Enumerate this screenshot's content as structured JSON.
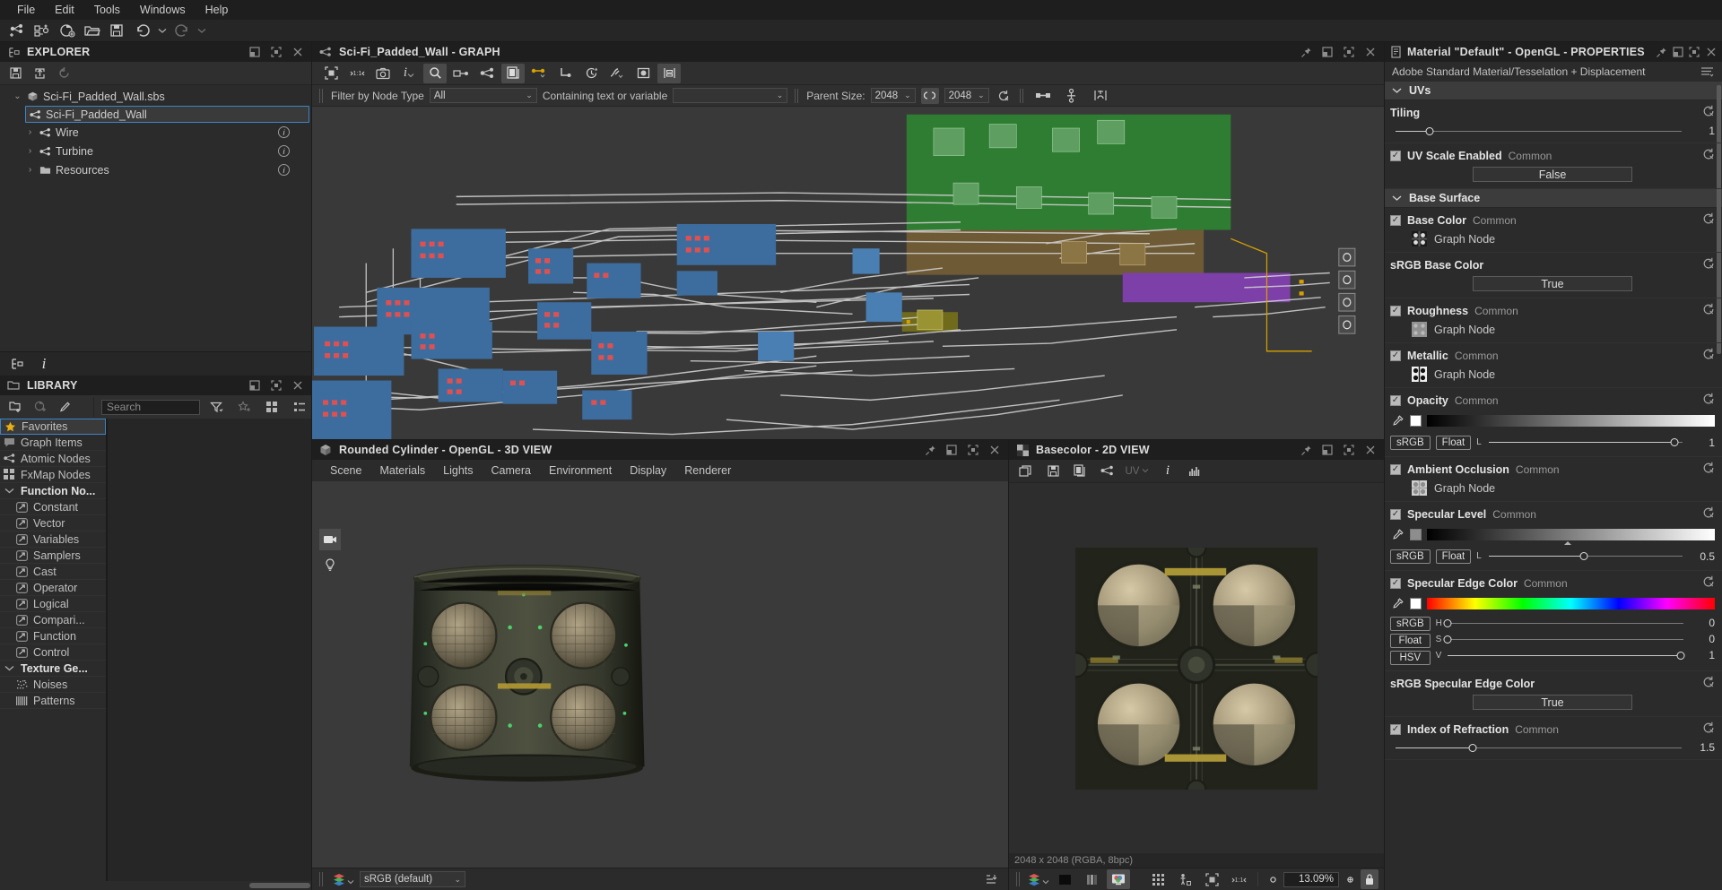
{
  "menubar": [
    "File",
    "Edit",
    "Tools",
    "Windows",
    "Help"
  ],
  "main_toolbar": [
    {
      "name": "new-graph-icon",
      "title": "New Graph"
    },
    {
      "name": "new-substance-icon",
      "title": "New Substance"
    },
    {
      "name": "new-package-icon",
      "title": "New Package"
    },
    {
      "name": "open-folder-icon",
      "title": "Open"
    },
    {
      "name": "save-icon",
      "title": "Save"
    },
    {
      "name": "undo-icon",
      "title": "Undo"
    },
    {
      "name": "undo-dropdown-icon",
      "title": "Undo history"
    },
    {
      "name": "redo-icon",
      "title": "Redo"
    },
    {
      "name": "redo-dropdown-icon",
      "title": "Redo history"
    }
  ],
  "explorer": {
    "title": "EXPLORER",
    "toolbar": [
      "save-package-icon",
      "export-icon",
      "refresh-icon"
    ],
    "tree": [
      {
        "label": "Sci-Fi_Padded_Wall.sbs",
        "icon": "package-icon",
        "depth": 0,
        "expanded": true,
        "selected": false,
        "info": false
      },
      {
        "label": "Sci-Fi_Padded_Wall",
        "icon": "graph-icon",
        "depth": 1,
        "expanded": false,
        "selected": true,
        "info": false
      },
      {
        "label": "Wire",
        "icon": "graph-icon",
        "depth": 1,
        "expanded": false,
        "selected": false,
        "info": true
      },
      {
        "label": "Turbine",
        "icon": "graph-icon",
        "depth": 1,
        "expanded": false,
        "selected": false,
        "info": true
      },
      {
        "label": "Resources",
        "icon": "folder-icon",
        "depth": 1,
        "expanded": false,
        "selected": false,
        "info": true
      }
    ],
    "bottom_tabs": [
      "explorer-tab-icon",
      "info-tab-icon"
    ]
  },
  "library": {
    "title": "LIBRARY",
    "toolbar": [
      "new-category-icon",
      "new-item-icon",
      "edit-icon"
    ],
    "search": {
      "value": "",
      "placeholder": "Search"
    },
    "filter_icons": [
      "filter-icon",
      "favorite-filter-icon",
      "grid-view-icon",
      "list-view-icon"
    ],
    "items": [
      {
        "label": "Favorites",
        "icon": "star-icon",
        "type": "item",
        "selected": true
      },
      {
        "label": "Graph Items",
        "icon": "comment-icon",
        "type": "item",
        "selected": false
      },
      {
        "label": "Atomic Nodes",
        "icon": "atomic-icon",
        "type": "item",
        "selected": false
      },
      {
        "label": "FxMap Nodes",
        "icon": "fxmap-icon",
        "type": "item",
        "selected": false
      },
      {
        "label": "Function No...",
        "icon": "chevron-down-icon",
        "type": "group",
        "selected": false
      },
      {
        "label": "Constant",
        "icon": "function-icon",
        "type": "sub",
        "selected": false
      },
      {
        "label": "Vector",
        "icon": "function-icon",
        "type": "sub",
        "selected": false
      },
      {
        "label": "Variables",
        "icon": "function-icon",
        "type": "sub",
        "selected": false
      },
      {
        "label": "Samplers",
        "icon": "function-icon",
        "type": "sub",
        "selected": false
      },
      {
        "label": "Cast",
        "icon": "function-icon",
        "type": "sub",
        "selected": false
      },
      {
        "label": "Operator",
        "icon": "function-icon",
        "type": "sub",
        "selected": false
      },
      {
        "label": "Logical",
        "icon": "function-icon",
        "type": "sub",
        "selected": false
      },
      {
        "label": "Compari...",
        "icon": "function-icon",
        "type": "sub",
        "selected": false
      },
      {
        "label": "Function",
        "icon": "function-icon",
        "type": "sub",
        "selected": false
      },
      {
        "label": "Control",
        "icon": "function-icon",
        "type": "sub",
        "selected": false
      },
      {
        "label": "Texture Ge...",
        "icon": "chevron-down-icon",
        "type": "group",
        "selected": false
      },
      {
        "label": "Noises",
        "icon": "noise-icon",
        "type": "sub",
        "selected": false
      },
      {
        "label": "Patterns",
        "icon": "pattern-icon",
        "type": "sub",
        "selected": false
      }
    ]
  },
  "graph": {
    "title": "Sci-Fi_Padded_Wall - GRAPH",
    "toolbar": [
      "fit-frame-icon",
      "scale-1to1-icon",
      "camera-icon",
      "info-icon",
      "search-icon",
      "link-creation-icon",
      "atomic-node-icon",
      "copy-node-icon",
      "connect-dots-icon",
      "polyline-link-icon",
      "timer-icon",
      "curve-link-icon",
      "preview-node-icon",
      "align-nodes-icon"
    ],
    "filter_label": "Filter by Node Type",
    "filter_value": "All",
    "contains_label": "Containing text or variable",
    "contains_value": "",
    "parent_size_label": "Parent Size:",
    "parent_size_w": "2048",
    "parent_size_h": "2048",
    "right_icons": [
      "link-toggle-icon",
      "node-chain-icon",
      "graph-settings-icon"
    ]
  },
  "view3d": {
    "title": "Rounded Cylinder - OpenGL - 3D VIEW",
    "menu": [
      "Scene",
      "Materials",
      "Lights",
      "Camera",
      "Environment",
      "Display",
      "Renderer"
    ],
    "colorspace": "sRGB (default)",
    "left_icons": [
      "camera-icon",
      "light-bulb-icon"
    ],
    "status_right_icon": "sort-icon"
  },
  "view2d": {
    "title": "Basecolor - 2D VIEW",
    "toolbar": [
      "duplicate-view-icon",
      "save-image-icon",
      "copy-image-icon",
      "link-graph-icon",
      "uv-icon",
      "info-icon",
      "histogram-icon"
    ],
    "uv_label": "UV",
    "image_info": "2048 x 2048 (RGBA, 8bpc)",
    "channel_icons": [
      "layers-icon",
      "black-swatch-icon",
      "channels-icon",
      "rgb-view-icon"
    ],
    "right_icons": [
      "tiling-grid-icon",
      "human-scale-icon",
      "fit-icon",
      "scale-1to1-icon"
    ],
    "zoom_out": "-",
    "zoom_value": "13.09%",
    "zoom_in": "+",
    "lock_icon": "lock-icon"
  },
  "properties": {
    "title": "Material \"Default\" - OpenGL - PROPERTIES",
    "subtitle": "Adobe Standard Material/Tesselation + Displacement",
    "menu_icon": "properties-menu-icon",
    "sections": [
      {
        "name": "UVs",
        "items": [
          {
            "kind": "slider",
            "label": "Tiling",
            "checkbox": false,
            "value": "1",
            "pct": 12
          },
          {
            "kind": "enum",
            "label": "UV Scale Enabled",
            "common": "Common",
            "checkbox": true,
            "value": "False"
          }
        ]
      },
      {
        "name": "Base Surface",
        "items": [
          {
            "kind": "node",
            "label": "Base Color",
            "common": "Common",
            "checkbox": true,
            "node": "Graph Node",
            "thumb": "basecolor"
          },
          {
            "kind": "enum",
            "label": "sRGB Base Color",
            "checkbox": false,
            "value": "True"
          },
          {
            "kind": "node",
            "label": "Roughness",
            "common": "Common",
            "checkbox": true,
            "node": "Graph Node",
            "thumb": "roughness"
          },
          {
            "kind": "node",
            "label": "Metallic",
            "common": "Common",
            "checkbox": true,
            "node": "Graph Node",
            "thumb": "metallic"
          },
          {
            "kind": "colorfloat",
            "label": "Opacity",
            "common": "Common",
            "checkbox": true,
            "swatch": "#ffffff",
            "gradient": "bw",
            "tags": [
              "sRGB",
              "Float"
            ],
            "channel": "L",
            "value": "1",
            "pct": 96
          },
          {
            "kind": "node",
            "label": "Ambient Occlusion",
            "common": "Common",
            "checkbox": true,
            "node": "Graph Node",
            "thumb": "ao"
          },
          {
            "kind": "colorfloat",
            "label": "Specular Level",
            "common": "Common",
            "checkbox": true,
            "swatch": "#8d8d8d",
            "gradient": "bw",
            "tags": [
              "sRGB",
              "Float"
            ],
            "channel": "L",
            "value": "0.5",
            "pct": 49,
            "markerpct": 49
          },
          {
            "kind": "hsv",
            "label": "Specular Edge Color",
            "common": "Common",
            "checkbox": true,
            "swatch": "#ffffff",
            "gradient": "hue",
            "tags": [
              "sRGB",
              "Float",
              "HSV"
            ],
            "channels": [
              {
                "code": "H",
                "value": "0",
                "pct": 0
              },
              {
                "code": "S",
                "value": "0",
                "pct": 0
              },
              {
                "code": "V",
                "value": "1",
                "pct": 99
              }
            ]
          },
          {
            "kind": "enum",
            "label": "sRGB Specular Edge Color",
            "checkbox": false,
            "value": "True"
          },
          {
            "kind": "slider",
            "label": "Index of Refraction",
            "common": "Common",
            "checkbox": true,
            "value": "1.5",
            "pct": 27
          }
        ]
      }
    ]
  },
  "colors": {
    "accent_blue": "#3d84c6",
    "accent_yellow": "#d8a100",
    "panel_bg": "#2b2b2b",
    "title_bg": "#1e1e1e",
    "graph_bg": "#393939",
    "node_blue": "#3d6d9e",
    "node_green": "#2f7d32",
    "node_purple": "#7d3fa8"
  }
}
